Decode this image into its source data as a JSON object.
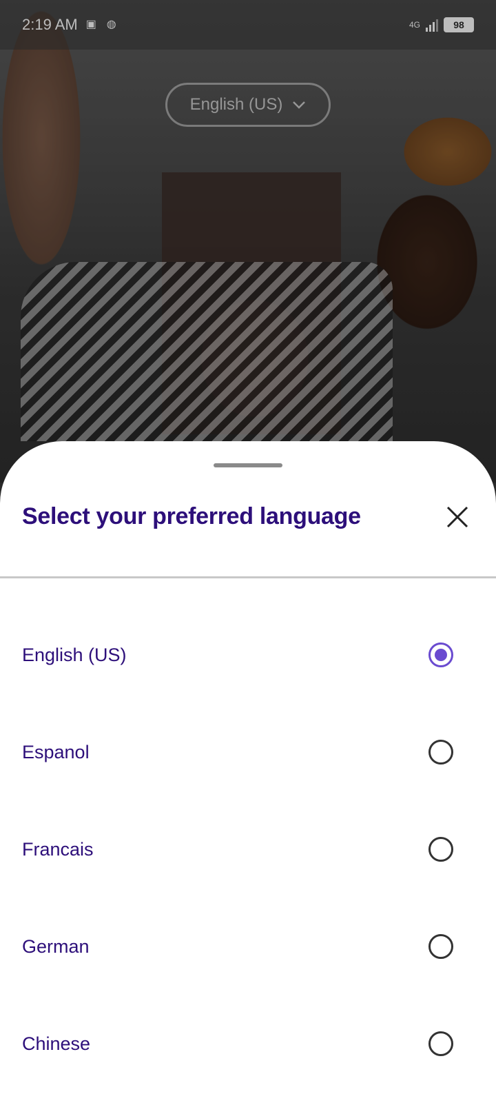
{
  "status_bar": {
    "time": "2:19 AM",
    "network": "4G",
    "battery": "98"
  },
  "top_language_selector": {
    "label": "English (US)",
    "icon": "chevron-down-icon"
  },
  "sheet": {
    "title": "Select your preferred language",
    "close_icon": "close-icon",
    "options": [
      {
        "label": "English (US)",
        "selected": true
      },
      {
        "label": "Espanol",
        "selected": false
      },
      {
        "label": "Francais",
        "selected": false
      },
      {
        "label": "German",
        "selected": false
      },
      {
        "label": "Chinese",
        "selected": false
      }
    ]
  },
  "colors": {
    "title": "#2d0f7a",
    "accent": "#6a4bd0"
  }
}
